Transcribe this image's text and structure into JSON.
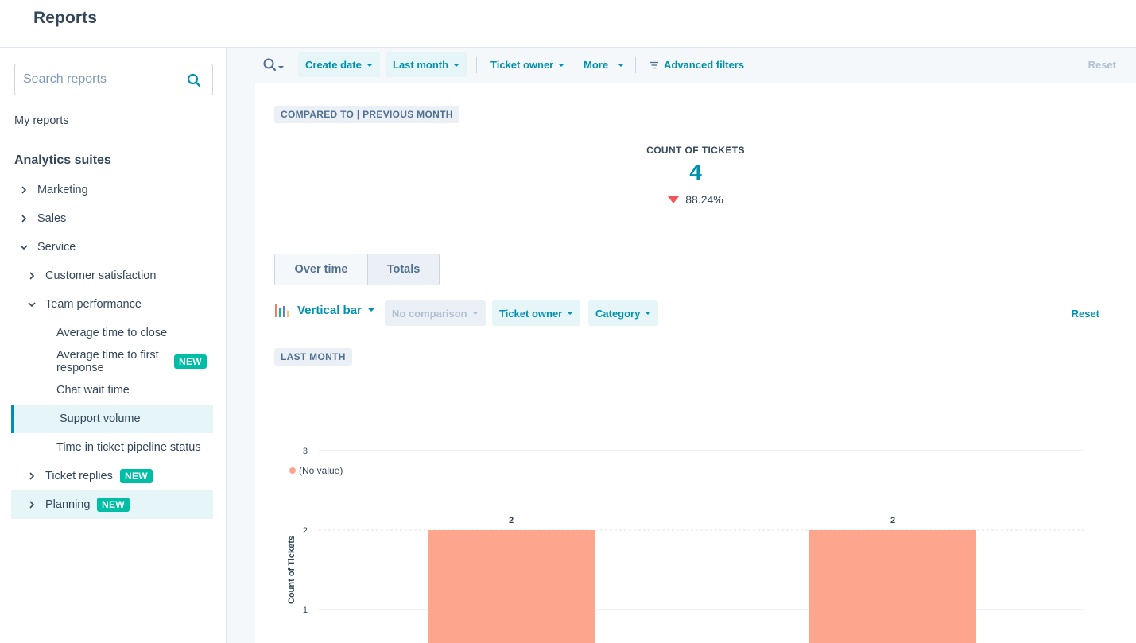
{
  "app": {
    "title": "Reports"
  },
  "sidebar": {
    "search_placeholder": "Search reports",
    "my_reports": "My reports",
    "suites_heading": "Analytics suites",
    "items": [
      {
        "label": "Marketing",
        "expanded": false
      },
      {
        "label": "Sales",
        "expanded": false
      },
      {
        "label": "Service",
        "expanded": true
      },
      {
        "label": "Customer satisfaction",
        "expanded": false
      },
      {
        "label": "Team performance",
        "expanded": true
      },
      {
        "label": "Average time to close"
      },
      {
        "label": "Average time to first response",
        "badge": "NEW"
      },
      {
        "label": "Chat wait time"
      },
      {
        "label": "Support volume",
        "active": true
      },
      {
        "label": "Time in ticket pipeline status"
      },
      {
        "label": "Ticket replies",
        "badge": "NEW"
      },
      {
        "label": "Planning",
        "badge": "NEW"
      }
    ]
  },
  "filters": {
    "create_date": "Create date",
    "last_month": "Last month",
    "ticket_owner": "Ticket owner",
    "more": "More",
    "advanced": "Advanced filters",
    "reset": "Reset"
  },
  "report": {
    "compared_to": "COMPARED TO | PREVIOUS MONTH",
    "kpi_label": "COUNT OF TICKETS",
    "kpi_value": "4",
    "kpi_change": "88.24%",
    "tabs": [
      "Over time",
      "Totals"
    ],
    "viz_type": "Vertical bar",
    "no_comparison": "No comparison",
    "ticket_owner": "Ticket owner",
    "category": "Category",
    "reset": "Reset",
    "period_tag": "LAST MONTH"
  },
  "colors": {
    "accent": "#0091ae",
    "bar": "#fea58e",
    "badge": "#00bda5",
    "down": "#f2545b"
  },
  "chart_data": {
    "type": "bar",
    "categories": [
      "",
      ""
    ],
    "series": [
      {
        "name": "(No value)",
        "values": [
          2,
          2
        ]
      }
    ],
    "data_labels": [
      "2",
      "2"
    ],
    "ylabel": "Count of Tickets",
    "xlabel": "",
    "ylim": [
      0,
      3
    ],
    "yticks": [
      1,
      2,
      3
    ],
    "legend": "top-left",
    "grid": true
  }
}
